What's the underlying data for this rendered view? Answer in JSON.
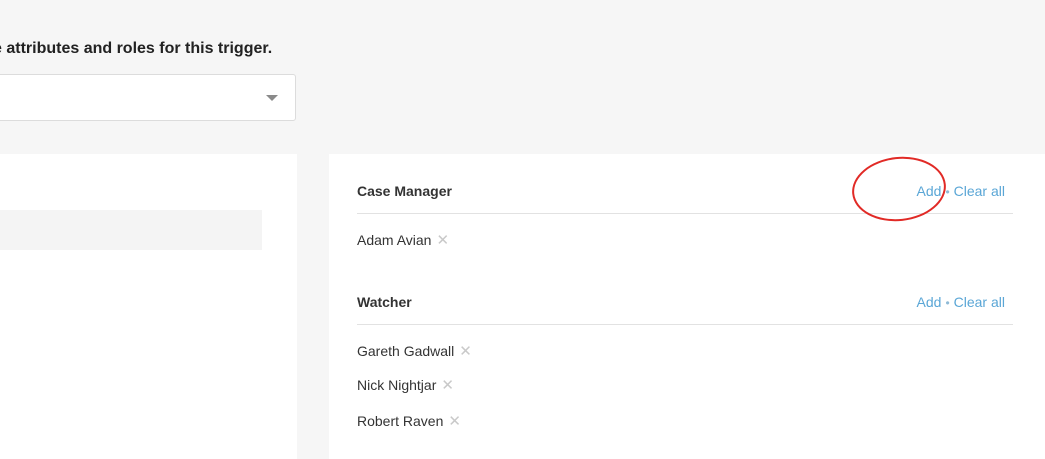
{
  "instruction": {
    "text": "e attributes and roles for this trigger."
  },
  "trigger_select": {
    "selected": ""
  },
  "roles": [
    {
      "title": "Case Manager",
      "add_label": "Add",
      "separator": "•",
      "clear_label": "Clear all",
      "members": [
        "Adam Avian"
      ]
    },
    {
      "title": "Watcher",
      "add_label": "Add",
      "separator": "•",
      "clear_label": "Clear all",
      "members": [
        "Gareth Gadwall",
        "Nick Nightjar",
        "Robert Raven"
      ]
    }
  ],
  "remove_glyph": "✕",
  "colors": {
    "link": "#5aa6d6",
    "annotation": "#e12a26"
  }
}
